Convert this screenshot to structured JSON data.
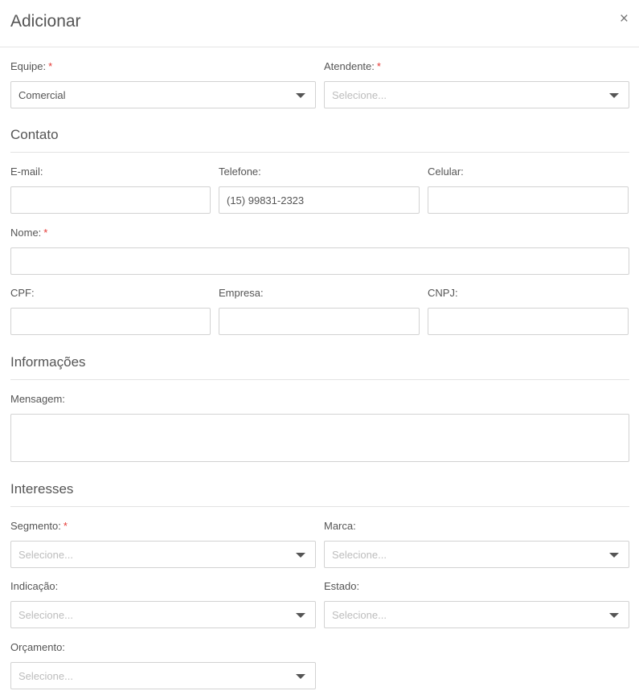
{
  "modal": {
    "title": "Adicionar",
    "close_glyph": "×"
  },
  "team": {
    "label": "Equipe:",
    "value": "Comercial"
  },
  "attendant": {
    "label": "Atendente:",
    "placeholder": "Selecione..."
  },
  "contact": {
    "section_title": "Contato",
    "email_label": "E-mail:",
    "phone_label": "Telefone:",
    "phone_value": "(15) 99831-2323",
    "mobile_label": "Celular:",
    "name_label": "Nome:",
    "cpf_label": "CPF:",
    "company_label": "Empresa:",
    "cnpj_label": "CNPJ:"
  },
  "info": {
    "section_title": "Informações",
    "message_label": "Mensagem:"
  },
  "interests": {
    "section_title": "Interesses",
    "segment_label": "Segmento:",
    "segment_placeholder": "Selecione...",
    "brand_label": "Marca:",
    "brand_placeholder": "Selecione...",
    "referral_label": "Indicação:",
    "referral_placeholder": "Selecione...",
    "state_label": "Estado:",
    "state_placeholder": "Selecione...",
    "budget_label": "Orçamento:",
    "budget_placeholder": "Selecione..."
  },
  "required_marker": "*",
  "icons": {
    "close": "close-icon",
    "dropdown": "caret-down-icon"
  },
  "colors": {
    "required": "#e53935",
    "border": "#d2d2d2",
    "text": "#555555",
    "placeholder": "#bdbdbd"
  }
}
